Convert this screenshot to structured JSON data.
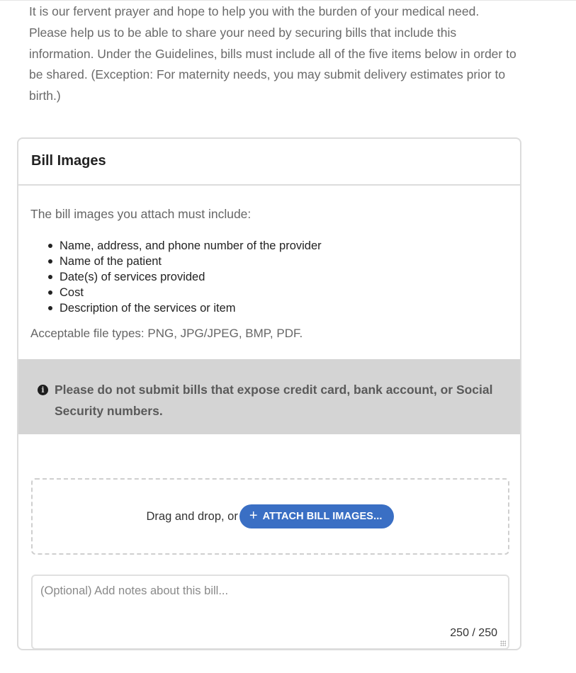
{
  "intro": {
    "paragraph": "It is our fervent prayer and hope to help you with the burden of your medical need. Please help us to be able to share your need by securing bills that include this information. Under the Guidelines, bills must include all of the five items below in order to be shared. (Exception: For maternity needs, you may submit delivery estimates prior to birth.)"
  },
  "card": {
    "title": "Bill Images",
    "requirements_intro": "The bill images you attach must include:",
    "requirements": [
      "Name, address, and phone number of the provider",
      "Name of the patient",
      "Date(s) of services provided",
      "Cost",
      "Description of the services or item"
    ],
    "file_types": "Acceptable file types: PNG, JPG/JPEG, BMP, PDF.",
    "warning": {
      "icon": "info-icon",
      "text": "Please do not submit bills that expose credit card, bank account, or Social Security numbers."
    },
    "dropzone": {
      "text": "Drag and drop, or",
      "button_icon": "plus-icon",
      "button_label": "ATTACH BILL IMAGES..."
    },
    "notes": {
      "placeholder": "(Optional) Add notes about this bill...",
      "value": "",
      "char_count": "250 / 250"
    }
  },
  "colors": {
    "button": "#3a6fc4",
    "warning_background": "#d4d4d4",
    "border": "#dcdcdc"
  }
}
